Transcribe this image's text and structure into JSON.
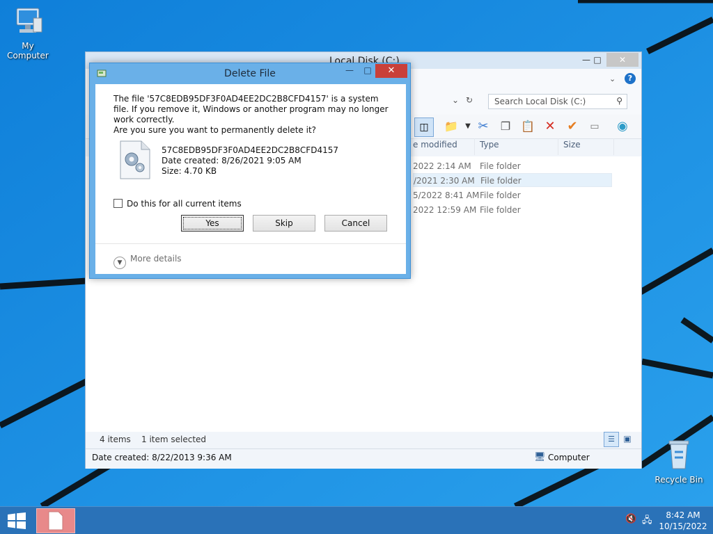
{
  "desktop": {
    "icons": [
      {
        "label": "My Computer"
      },
      {
        "label": "Recycle Bin"
      }
    ]
  },
  "explorer": {
    "title": "Local Disk (C:)",
    "search_placeholder": "Search Local Disk (C:)",
    "columns": [
      "e modified",
      "Type",
      "Size"
    ],
    "rows": [
      {
        "date": "2022 2:14 AM",
        "type": "File folder",
        "selected": false
      },
      {
        "date": "/2021 2:30 AM",
        "type": "File folder",
        "selected": true
      },
      {
        "date": "5/2022 8:41 AM",
        "type": "File folder",
        "selected": false
      },
      {
        "date": "2022 12:59 AM",
        "type": "File folder",
        "selected": false
      }
    ],
    "status_items": "4 items",
    "status_selected": "1 item selected",
    "status_date_created": "Date created: 8/22/2013 9:36 AM",
    "status_location": "Computer"
  },
  "dialog": {
    "title": "Delete File",
    "message": "The file '57C8EDB95DF3F0AD4EE2DC2B8CFD4157' is a system file. If you remove it, Windows or another program may no longer work correctly.",
    "question": "Are you sure you want to permanently delete it?",
    "file_name": "57C8EDB95DF3F0AD4EE2DC2B8CFD4157",
    "date_created": "Date created: 8/26/2021 9:05 AM",
    "size": "Size: 4.70 KB",
    "checkbox_label": "Do this for all current items",
    "checkbox_checked": false,
    "buttons": {
      "yes": "Yes",
      "skip": "Skip",
      "cancel": "Cancel"
    },
    "more_details": "More details"
  },
  "taskbar": {
    "time": "8:42 AM",
    "date": "10/15/2022"
  },
  "colors": {
    "desktop_bg": "#1a8be0",
    "dialog_frame": "#6ab0e8",
    "close_red": "#c9403a",
    "taskbar": "#2a72b8"
  }
}
